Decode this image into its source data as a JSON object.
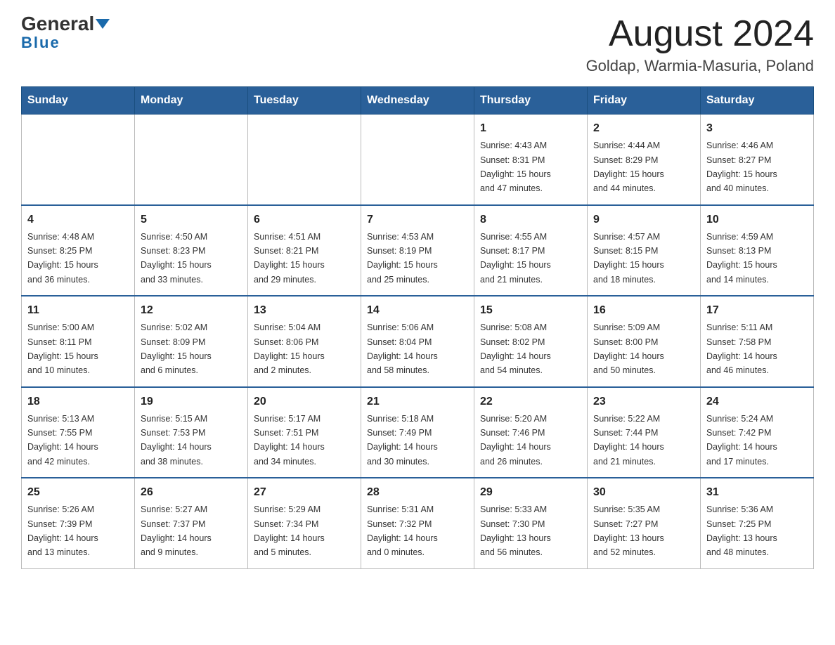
{
  "header": {
    "logo_general": "General",
    "logo_blue": "Blue",
    "month_title": "August 2024",
    "location": "Goldap, Warmia-Masuria, Poland"
  },
  "weekdays": [
    "Sunday",
    "Monday",
    "Tuesday",
    "Wednesday",
    "Thursday",
    "Friday",
    "Saturday"
  ],
  "weeks": [
    [
      {
        "day": "",
        "info": ""
      },
      {
        "day": "",
        "info": ""
      },
      {
        "day": "",
        "info": ""
      },
      {
        "day": "",
        "info": ""
      },
      {
        "day": "1",
        "info": "Sunrise: 4:43 AM\nSunset: 8:31 PM\nDaylight: 15 hours\nand 47 minutes."
      },
      {
        "day": "2",
        "info": "Sunrise: 4:44 AM\nSunset: 8:29 PM\nDaylight: 15 hours\nand 44 minutes."
      },
      {
        "day": "3",
        "info": "Sunrise: 4:46 AM\nSunset: 8:27 PM\nDaylight: 15 hours\nand 40 minutes."
      }
    ],
    [
      {
        "day": "4",
        "info": "Sunrise: 4:48 AM\nSunset: 8:25 PM\nDaylight: 15 hours\nand 36 minutes."
      },
      {
        "day": "5",
        "info": "Sunrise: 4:50 AM\nSunset: 8:23 PM\nDaylight: 15 hours\nand 33 minutes."
      },
      {
        "day": "6",
        "info": "Sunrise: 4:51 AM\nSunset: 8:21 PM\nDaylight: 15 hours\nand 29 minutes."
      },
      {
        "day": "7",
        "info": "Sunrise: 4:53 AM\nSunset: 8:19 PM\nDaylight: 15 hours\nand 25 minutes."
      },
      {
        "day": "8",
        "info": "Sunrise: 4:55 AM\nSunset: 8:17 PM\nDaylight: 15 hours\nand 21 minutes."
      },
      {
        "day": "9",
        "info": "Sunrise: 4:57 AM\nSunset: 8:15 PM\nDaylight: 15 hours\nand 18 minutes."
      },
      {
        "day": "10",
        "info": "Sunrise: 4:59 AM\nSunset: 8:13 PM\nDaylight: 15 hours\nand 14 minutes."
      }
    ],
    [
      {
        "day": "11",
        "info": "Sunrise: 5:00 AM\nSunset: 8:11 PM\nDaylight: 15 hours\nand 10 minutes."
      },
      {
        "day": "12",
        "info": "Sunrise: 5:02 AM\nSunset: 8:09 PM\nDaylight: 15 hours\nand 6 minutes."
      },
      {
        "day": "13",
        "info": "Sunrise: 5:04 AM\nSunset: 8:06 PM\nDaylight: 15 hours\nand 2 minutes."
      },
      {
        "day": "14",
        "info": "Sunrise: 5:06 AM\nSunset: 8:04 PM\nDaylight: 14 hours\nand 58 minutes."
      },
      {
        "day": "15",
        "info": "Sunrise: 5:08 AM\nSunset: 8:02 PM\nDaylight: 14 hours\nand 54 minutes."
      },
      {
        "day": "16",
        "info": "Sunrise: 5:09 AM\nSunset: 8:00 PM\nDaylight: 14 hours\nand 50 minutes."
      },
      {
        "day": "17",
        "info": "Sunrise: 5:11 AM\nSunset: 7:58 PM\nDaylight: 14 hours\nand 46 minutes."
      }
    ],
    [
      {
        "day": "18",
        "info": "Sunrise: 5:13 AM\nSunset: 7:55 PM\nDaylight: 14 hours\nand 42 minutes."
      },
      {
        "day": "19",
        "info": "Sunrise: 5:15 AM\nSunset: 7:53 PM\nDaylight: 14 hours\nand 38 minutes."
      },
      {
        "day": "20",
        "info": "Sunrise: 5:17 AM\nSunset: 7:51 PM\nDaylight: 14 hours\nand 34 minutes."
      },
      {
        "day": "21",
        "info": "Sunrise: 5:18 AM\nSunset: 7:49 PM\nDaylight: 14 hours\nand 30 minutes."
      },
      {
        "day": "22",
        "info": "Sunrise: 5:20 AM\nSunset: 7:46 PM\nDaylight: 14 hours\nand 26 minutes."
      },
      {
        "day": "23",
        "info": "Sunrise: 5:22 AM\nSunset: 7:44 PM\nDaylight: 14 hours\nand 21 minutes."
      },
      {
        "day": "24",
        "info": "Sunrise: 5:24 AM\nSunset: 7:42 PM\nDaylight: 14 hours\nand 17 minutes."
      }
    ],
    [
      {
        "day": "25",
        "info": "Sunrise: 5:26 AM\nSunset: 7:39 PM\nDaylight: 14 hours\nand 13 minutes."
      },
      {
        "day": "26",
        "info": "Sunrise: 5:27 AM\nSunset: 7:37 PM\nDaylight: 14 hours\nand 9 minutes."
      },
      {
        "day": "27",
        "info": "Sunrise: 5:29 AM\nSunset: 7:34 PM\nDaylight: 14 hours\nand 5 minutes."
      },
      {
        "day": "28",
        "info": "Sunrise: 5:31 AM\nSunset: 7:32 PM\nDaylight: 14 hours\nand 0 minutes."
      },
      {
        "day": "29",
        "info": "Sunrise: 5:33 AM\nSunset: 7:30 PM\nDaylight: 13 hours\nand 56 minutes."
      },
      {
        "day": "30",
        "info": "Sunrise: 5:35 AM\nSunset: 7:27 PM\nDaylight: 13 hours\nand 52 minutes."
      },
      {
        "day": "31",
        "info": "Sunrise: 5:36 AM\nSunset: 7:25 PM\nDaylight: 13 hours\nand 48 minutes."
      }
    ]
  ]
}
